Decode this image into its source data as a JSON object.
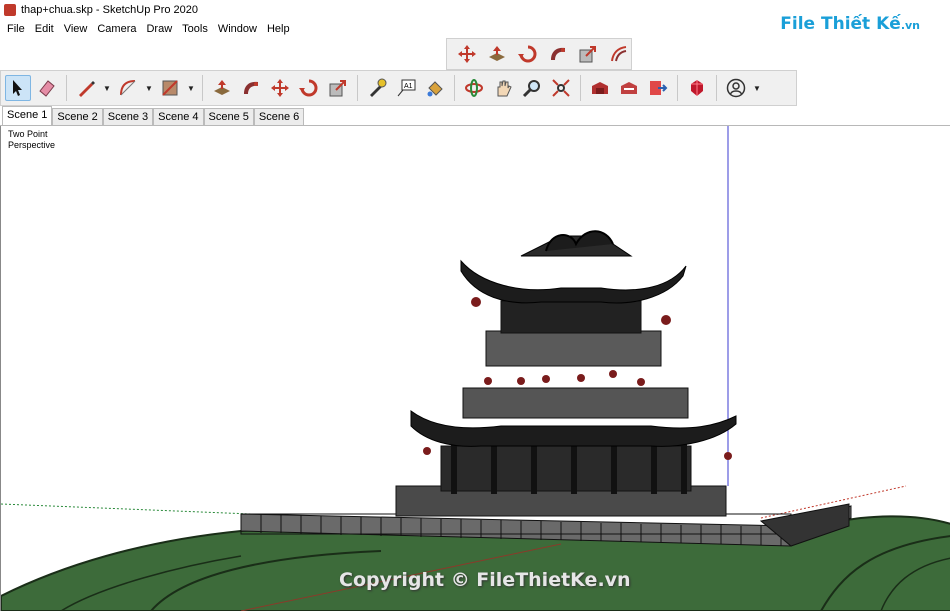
{
  "window": {
    "title": "thap+chua.skp - SketchUp Pro 2020"
  },
  "watermark": {
    "brand": "File Thiết Kế",
    "suffix": ".vn"
  },
  "menu": [
    "File",
    "Edit",
    "View",
    "Camera",
    "Draw",
    "Tools",
    "Window",
    "Help"
  ],
  "scenes": [
    "Scene 1",
    "Scene 2",
    "Scene 3",
    "Scene 4",
    "Scene 5",
    "Scene 6"
  ],
  "active_scene": "Scene 1",
  "camera": {
    "line1": "Two Point",
    "line2": "Perspective"
  },
  "copyright": "Copyright © FileThietKe.vn",
  "floating_toolbar_icons": [
    "move-icon",
    "push-pull-icon",
    "rotate-icon",
    "follow-me-icon",
    "scale-icon",
    "offset-icon"
  ],
  "main_toolbar_icons": [
    "select-icon",
    "eraser-icon",
    "line-icon",
    "arc-icon",
    "rectangle-icon",
    "push-pull-icon",
    "follow-me-icon",
    "move-icon",
    "rotate-icon",
    "scale-icon",
    "tape-measure-icon",
    "text-icon",
    "paint-bucket-icon",
    "orbit-icon",
    "pan-icon",
    "zoom-icon",
    "zoom-extents-icon",
    "warehouse-icon",
    "extension-warehouse-icon",
    "send-to-layout-icon",
    "ruby-icon",
    "user-icon"
  ],
  "colors": {
    "grass": "#3d6b3a",
    "structure": "#1c1c1c",
    "selection": "#cce4f7"
  }
}
